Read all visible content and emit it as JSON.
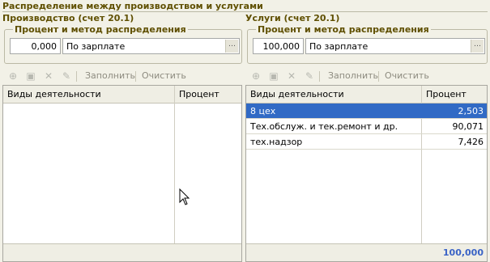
{
  "window": {
    "title": "Распределение между производством и услугами"
  },
  "left": {
    "title": "Производство (счет 20.1)",
    "group_label": "Процент и метод распределения",
    "percent": "0,000",
    "method": "По зарплате",
    "toolbar": {
      "fill": "Заполнить",
      "clear": "Очистить"
    },
    "columns": [
      "Виды деятельности",
      "Процент"
    ],
    "rows": [],
    "total": ""
  },
  "right": {
    "title": "Услуги (счет 20.1)",
    "group_label": "Процент и метод распределения",
    "percent": "100,000",
    "method": "По зарплате",
    "toolbar": {
      "fill": "Заполнить",
      "clear": "Очистить"
    },
    "columns": [
      "Виды деятельности",
      "Процент"
    ],
    "rows": [
      {
        "name": "8 цех",
        "percent": "2,503"
      },
      {
        "name": "Тех.обслуж. и тек.ремонт и др.",
        "percent": "90,071"
      },
      {
        "name": "тех.надзор",
        "percent": "7,426"
      }
    ],
    "total": "100,000"
  },
  "colors": {
    "accent_title": "#5f4f00",
    "selection": "#316ac5",
    "total": "#3a63c6"
  },
  "icons": [
    "add-icon",
    "copy-icon",
    "delete-icon",
    "edit-icon",
    "select-button-icon",
    "mouse-cursor-icon"
  ]
}
